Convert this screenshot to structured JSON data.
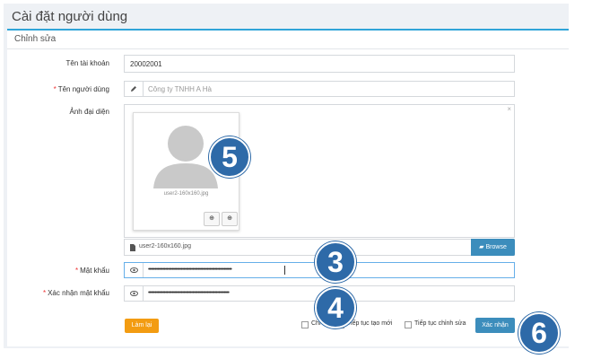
{
  "page": {
    "title": "Cài đặt người dùng"
  },
  "panel": {
    "title": "Chỉnh sửa"
  },
  "form": {
    "account": {
      "label": "Tên tài khoản",
      "value": "20002001"
    },
    "username": {
      "label": "Tên người dùng",
      "value": "Công ty TNHH A Hà",
      "icon": "pencil-icon"
    },
    "avatar": {
      "label": "Ảnh đại diện",
      "thumb_caption": "user2-160x160.jpg",
      "file_name": "user2-160x160.jpg",
      "browse_label": "Browse",
      "remove_label": "×"
    },
    "password": {
      "label": "Mật khẩu",
      "value": "••••••••••••••••••••••••••••••••••••••••••••••••••••••••••••••••",
      "icon": "eye-icon"
    },
    "confirm_password": {
      "label": "Xác nhận mật khẩu",
      "value": "••••••••••••••••••••••••••••••••••••••••••••••••••••••••••••••",
      "icon": "eye-icon"
    }
  },
  "footer": {
    "reset_label": "Làm lại",
    "checkboxes": [
      "Chi tiết",
      "Tiếp tục tạo mới",
      "Tiếp tục chỉnh sửa"
    ],
    "confirm_label": "Xác nhận"
  },
  "markers": [
    "5",
    "3",
    "4",
    "6"
  ],
  "colors": {
    "accent": "#3c8dbc",
    "orange": "#f39c12",
    "marker": "#2e6aa8",
    "required": "#ee3333"
  }
}
